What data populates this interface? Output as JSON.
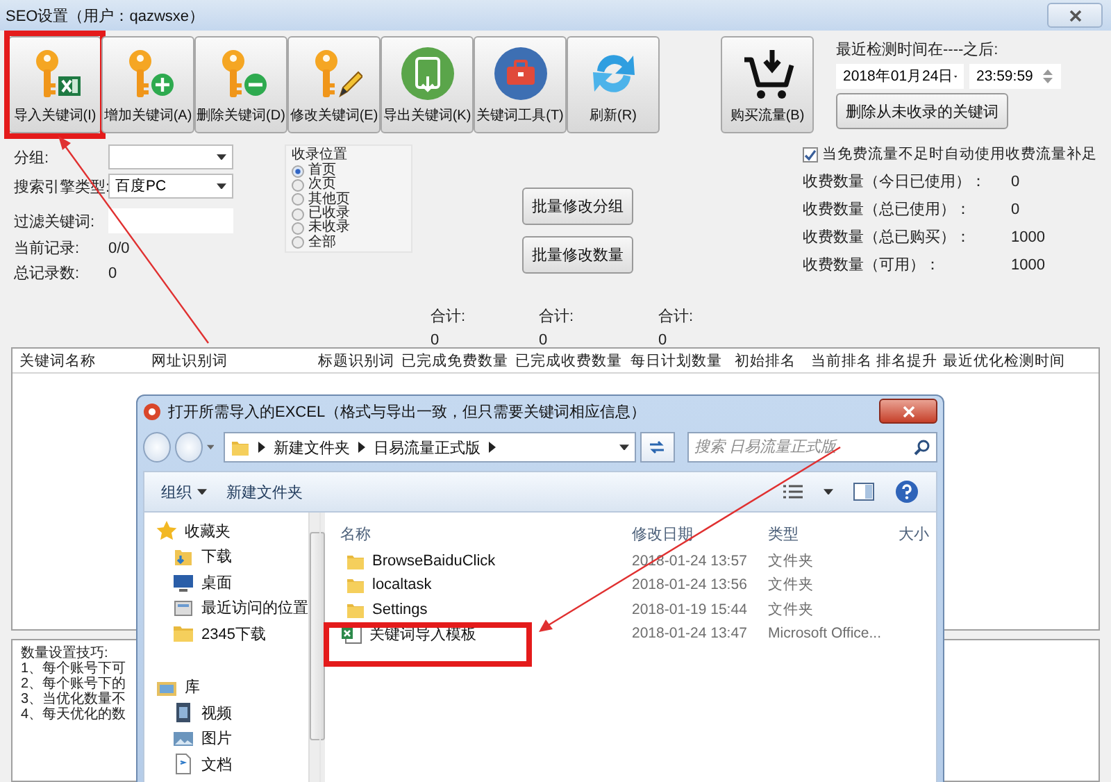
{
  "window": {
    "title": "SEO设置（用户：qazwsxe）"
  },
  "toolbar": [
    {
      "kind": "import",
      "label": "导入关键词(I)",
      "highlighted": true
    },
    {
      "kind": "add",
      "label": "增加关键词(A)",
      "highlighted": false
    },
    {
      "kind": "delete",
      "label": "删除关键词(D)",
      "highlighted": false
    },
    {
      "kind": "edit",
      "label": "修改关键词(E)",
      "highlighted": false
    },
    {
      "kind": "export",
      "label": "导出关键词(K)",
      "highlighted": false
    },
    {
      "kind": "tools",
      "label": "关键词工具(T)",
      "highlighted": false
    },
    {
      "kind": "refresh",
      "label": "刷新(R)",
      "highlighted": false
    }
  ],
  "buy_button": {
    "label": "购买流量(B)"
  },
  "check_time": {
    "label": "最近检测时间在----之后:",
    "date": "2018年01月24日",
    "time": "23:59:59",
    "delete_button": "删除从未收录的关键词"
  },
  "filters": {
    "group_label": "分组:",
    "engine_label": "搜索引擎类型:",
    "engine_value": "百度PC",
    "keyword_label": "过滤关键词:",
    "current_label": "当前记录:",
    "current_value": "0/0",
    "total_label": "总记录数:",
    "total_value": "0"
  },
  "index_position": {
    "title": "收录位置",
    "options": [
      {
        "label": "首页",
        "selected": true
      },
      {
        "label": "次页",
        "selected": false
      },
      {
        "label": "其他页",
        "selected": false
      },
      {
        "label": "已收录",
        "selected": false
      },
      {
        "label": "未收录",
        "selected": false
      },
      {
        "label": "全部",
        "selected": false
      }
    ]
  },
  "batch_buttons": [
    "批量修改分组",
    "批量修改数量"
  ],
  "paid": {
    "auto_fill": {
      "label": "当免费流量不足时自动使用收费流量补足",
      "checked": true
    },
    "stats": [
      {
        "label": "收费数量（今日已使用）：",
        "value": "0"
      },
      {
        "label": "收费数量（总已使用）：",
        "value": "0"
      },
      {
        "label": "收费数量（总已购买）：",
        "value": "1000"
      },
      {
        "label": "收费数量（可用）：",
        "value": "1000"
      }
    ]
  },
  "totals": [
    {
      "label": "合计:",
      "value": "0"
    },
    {
      "label": "合计:",
      "value": "0"
    },
    {
      "label": "合计:",
      "value": "0"
    }
  ],
  "table": {
    "columns": [
      "关键词名称",
      "网址识别词",
      "标题识别词",
      "已完成免费数量",
      "已完成收费数量",
      "每日计划数量",
      "初始排名",
      "当前排名",
      "排名提升",
      "最近优化检测时间"
    ]
  },
  "tips": {
    "lines": [
      "数量设置技巧:",
      "1、每个账号下可",
      "2、每个账号下的",
      "3、当优化数量不",
      "4、每天优化的数"
    ]
  },
  "dialog": {
    "title": "打开所需导入的EXCEL（格式与导出一致，但只需要关键词相应信息）",
    "path": [
      "新建文件夹",
      "日易流量正式版"
    ],
    "search_placeholder": "搜索 日易流量正式版",
    "commands": [
      "组织",
      "新建文件夹"
    ],
    "sidebar": [
      {
        "label": "收藏夹",
        "kind": "star",
        "children": [
          {
            "label": "下载",
            "kind": "download"
          },
          {
            "label": "桌面",
            "kind": "desktop"
          },
          {
            "label": "最近访问的位置",
            "kind": "recent"
          },
          {
            "label": "2345下载",
            "kind": "folder"
          }
        ]
      },
      {
        "label": "库",
        "kind": "library",
        "children": [
          {
            "label": "视频",
            "kind": "video"
          },
          {
            "label": "图片",
            "kind": "picture"
          },
          {
            "label": "文档",
            "kind": "document"
          }
        ]
      }
    ],
    "columns": [
      "名称",
      "修改日期",
      "类型",
      "大小"
    ],
    "files": [
      {
        "kind": "folder",
        "name": "BrowseBaiduClick",
        "date": "2018-01-24 13:57",
        "type": "文件夹",
        "highlighted": false
      },
      {
        "kind": "folder",
        "name": "localtask",
        "date": "2018-01-24 13:56",
        "type": "文件夹",
        "highlighted": false
      },
      {
        "kind": "folder",
        "name": "Settings",
        "date": "2018-01-19 15:44",
        "type": "文件夹",
        "highlighted": false
      },
      {
        "kind": "excel",
        "name": "关键词导入模板",
        "date": "2018-01-24 13:47",
        "type": "Microsoft Office...",
        "highlighted": true
      }
    ]
  }
}
